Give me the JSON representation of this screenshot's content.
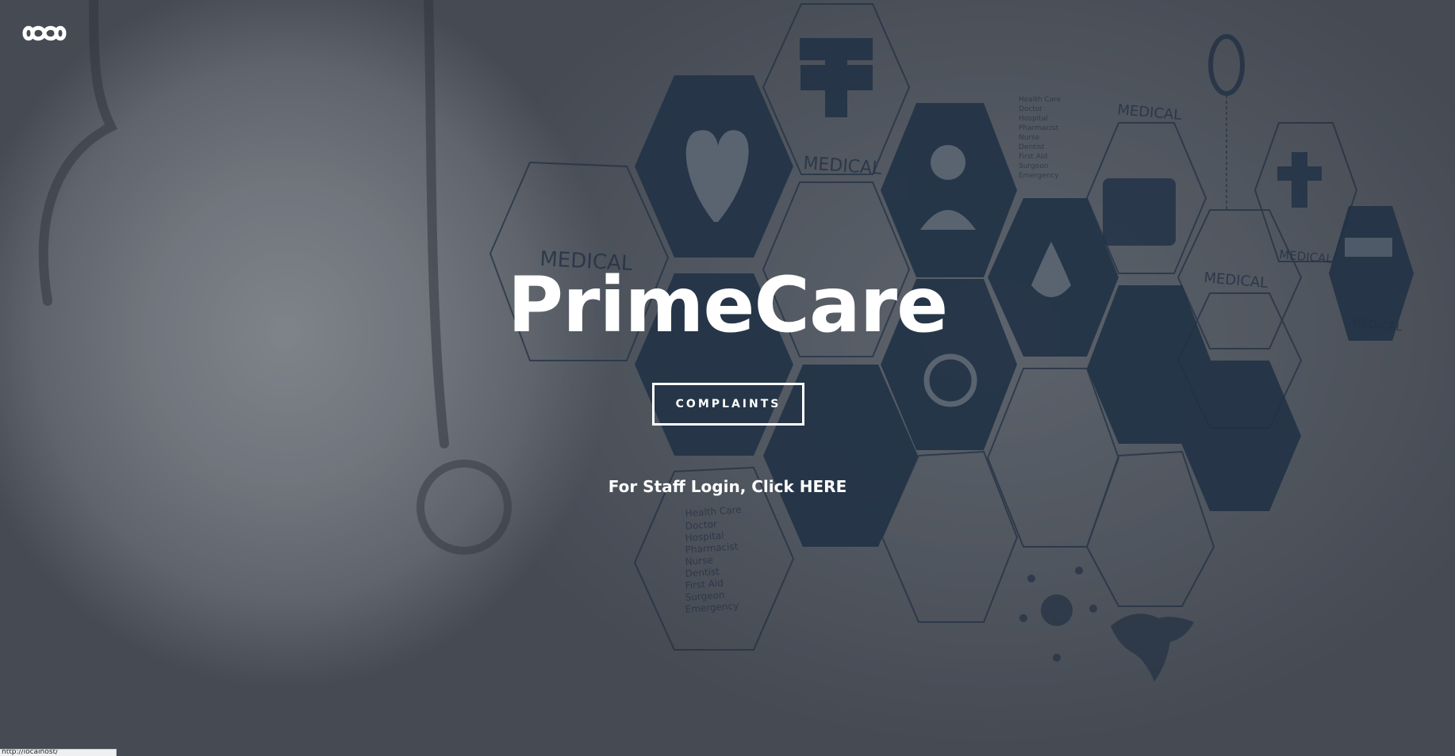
{
  "logo": {
    "icon": "infinity-icon",
    "color": "#ffffff"
  },
  "hero": {
    "title": "PrimeCare",
    "complaints_label": "COMPLAINTS",
    "staff_login_prefix": "For Staff Login, Click ",
    "staff_login_link": "HERE"
  },
  "background": {
    "hexagon_labels": {
      "medical": "MEDICAL",
      "list": [
        "Health Care",
        "Doctor",
        "Hospital",
        "Pharmacist",
        "Nurse",
        "Dentist",
        "First Aid",
        "Surgeon",
        "Emergency"
      ]
    },
    "colors": {
      "overlay": "#282c34",
      "hexagon_fill": "#1f3a57",
      "hexagon_stroke": "#2b3e52",
      "text": "#ffffff"
    }
  },
  "status_bar": {
    "url": "http://localhost/"
  }
}
